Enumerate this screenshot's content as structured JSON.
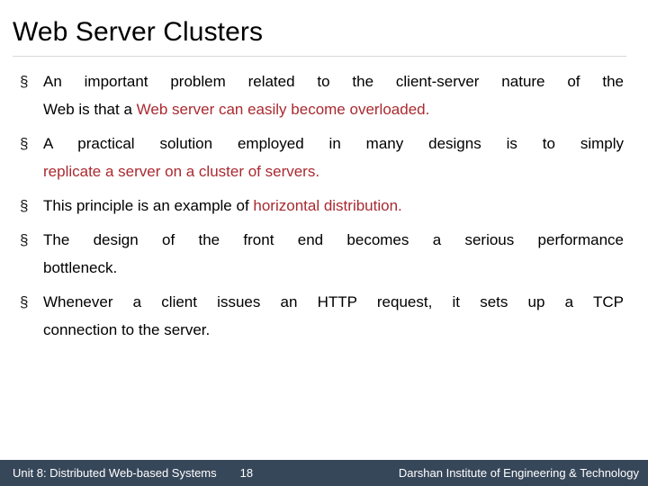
{
  "slide": {
    "title": "Web Server Clusters",
    "bullet_marker": "§",
    "bullets": [
      {
        "lines": [
          {
            "segments": [
              {
                "text": "An important problem related to the client-server nature of the",
                "style": "normal"
              }
            ],
            "last": false
          },
          {
            "segments": [
              {
                "text": "Web is that a ",
                "style": "normal"
              },
              {
                "text": "Web server can easily become overloaded.",
                "style": "highlight"
              }
            ],
            "last": true
          }
        ]
      },
      {
        "lines": [
          {
            "segments": [
              {
                "text": "A practical solution employed in many designs is to simply",
                "style": "normal"
              }
            ],
            "last": false
          },
          {
            "segments": [
              {
                "text": "replicate a server on a cluster of servers.",
                "style": "highlight"
              }
            ],
            "last": true
          }
        ]
      },
      {
        "lines": [
          {
            "segments": [
              {
                "text": "This principle is an example of ",
                "style": "normal"
              },
              {
                "text": "horizontal distribution.",
                "style": "highlight"
              }
            ],
            "last": true
          }
        ]
      },
      {
        "lines": [
          {
            "segments": [
              {
                "text": "The design of the front end becomes a serious performance",
                "style": "normal"
              }
            ],
            "last": false
          },
          {
            "segments": [
              {
                "text": "bottleneck.",
                "style": "normal"
              }
            ],
            "last": true
          }
        ]
      },
      {
        "lines": [
          {
            "segments": [
              {
                "text": "Whenever a client issues an HTTP request, it sets up a TCP",
                "style": "normal"
              }
            ],
            "last": false
          },
          {
            "segments": [
              {
                "text": "connection to the server.",
                "style": "normal"
              }
            ],
            "last": true
          }
        ]
      }
    ]
  },
  "footer": {
    "unit": "Unit 8: Distributed Web-based Systems",
    "page_number": "18",
    "organization": "Darshan Institute of Engineering & Technology",
    "background_color": "#37475a",
    "text_color": "#ffffff"
  },
  "theme": {
    "highlight_color": "#a92a30",
    "title_color": "#000000",
    "body_color": "#000000",
    "rule_color": "#d9d9d9",
    "background_color": "#ffffff"
  }
}
